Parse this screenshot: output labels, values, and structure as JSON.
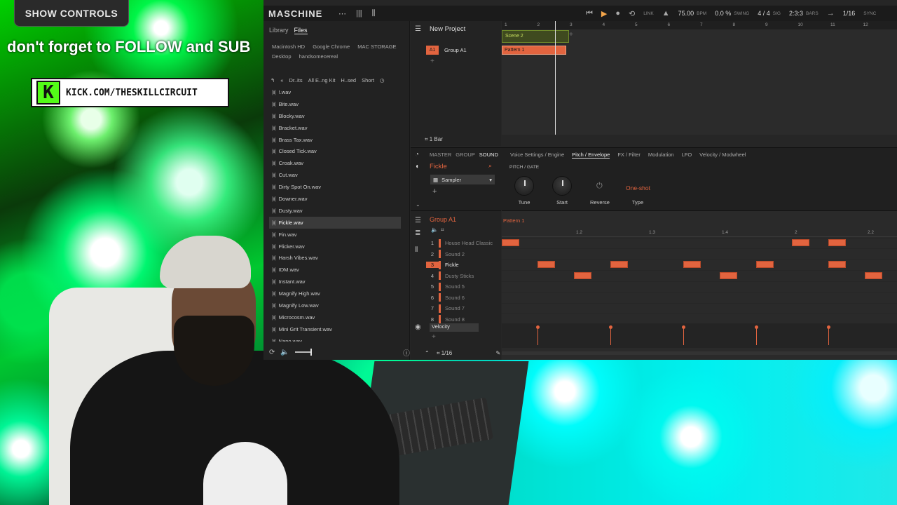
{
  "overlay": {
    "show_controls": "SHOW CONTROLS",
    "follow_text": "don't forget to FOLLOW and SUB",
    "kick_url": "KICK.COM/THESKILLCIRCUIT",
    "kick_logo": "K"
  },
  "app": {
    "logo": "MASCHINE",
    "transport": {
      "link": "LINK",
      "bpm_value": "75.00",
      "bpm_label": "BPM",
      "swing_value": "0.0 %",
      "swing_label": "SWING",
      "sig_value": "4 / 4",
      "sig_label": "SIG",
      "bars_value": "2:3:3",
      "bars_label": "BARS",
      "grid_value": "1/16",
      "sync_label": "SYNC"
    }
  },
  "browser": {
    "tabs": [
      "Library",
      "Files"
    ],
    "favorites": [
      "Macintosh HD",
      "Google Chrome",
      "MAC STORAGE",
      "Desktop",
      "handsomecereal"
    ],
    "crumbs": [
      "Dr..its",
      "All E..ng Kit",
      "H..sed",
      "Short"
    ],
    "files": [
      "!.wav",
      "Bite.wav",
      "Blocky.wav",
      "Bracket.wav",
      "Brass Tax.wav",
      "Closed Tick.wav",
      "Croak.wav",
      "Cut.wav",
      "Dirty Spot On.wav",
      "Downer.wav",
      "Dusty.wav",
      "Fickle.wav",
      "Fin.wav",
      "Flicker.wav",
      "Harsh Vibes.wav",
      "IDM.wav",
      "Instant.wav",
      "Magnify High.wav",
      "Magnify Low.wav",
      "Microcosm.wav",
      "Mini Grit Transient.wav",
      "Nano.wav"
    ],
    "selected_file": "Fickle.wav"
  },
  "arranger": {
    "project": "New Project",
    "group_tag": "A1",
    "group_name": "Group A1",
    "bar_length": "1 Bar",
    "ruler": [
      "1",
      "2",
      "3",
      "4",
      "5",
      "6",
      "7",
      "8",
      "9",
      "10",
      "11",
      "12"
    ],
    "scene": "Scene 2",
    "pattern": "Pattern 1"
  },
  "sound": {
    "tabs": [
      "MASTER",
      "GROUP",
      "SOUND"
    ],
    "name": "Fickle",
    "plugin": "Sampler",
    "param_tabs": [
      "Voice Settings / Engine",
      "Pitch / Envelope",
      "FX / Filter",
      "Modulation",
      "LFO",
      "Velocity / Modwheel"
    ],
    "section": "PITCH / GATE",
    "params": [
      "Tune",
      "Start",
      "Reverse",
      "Type"
    ],
    "type_value": "One-shot"
  },
  "pattern_editor": {
    "group": "Group A1",
    "pattern": "Pattern 1",
    "ruler": [
      "1.2",
      "1.3",
      "1.4",
      "2",
      "2.2"
    ],
    "sounds": [
      {
        "num": "1",
        "name": "House Head Classic"
      },
      {
        "num": "2",
        "name": "Sound 2"
      },
      {
        "num": "3",
        "name": "Fickle"
      },
      {
        "num": "4",
        "name": "Dusty Sticks"
      },
      {
        "num": "5",
        "name": "Sound 5"
      },
      {
        "num": "6",
        "name": "Sound 6"
      },
      {
        "num": "7",
        "name": "Sound 7"
      },
      {
        "num": "8",
        "name": "Sound 8"
      }
    ],
    "velocity_label": "Velocity",
    "grid": "1/16"
  }
}
